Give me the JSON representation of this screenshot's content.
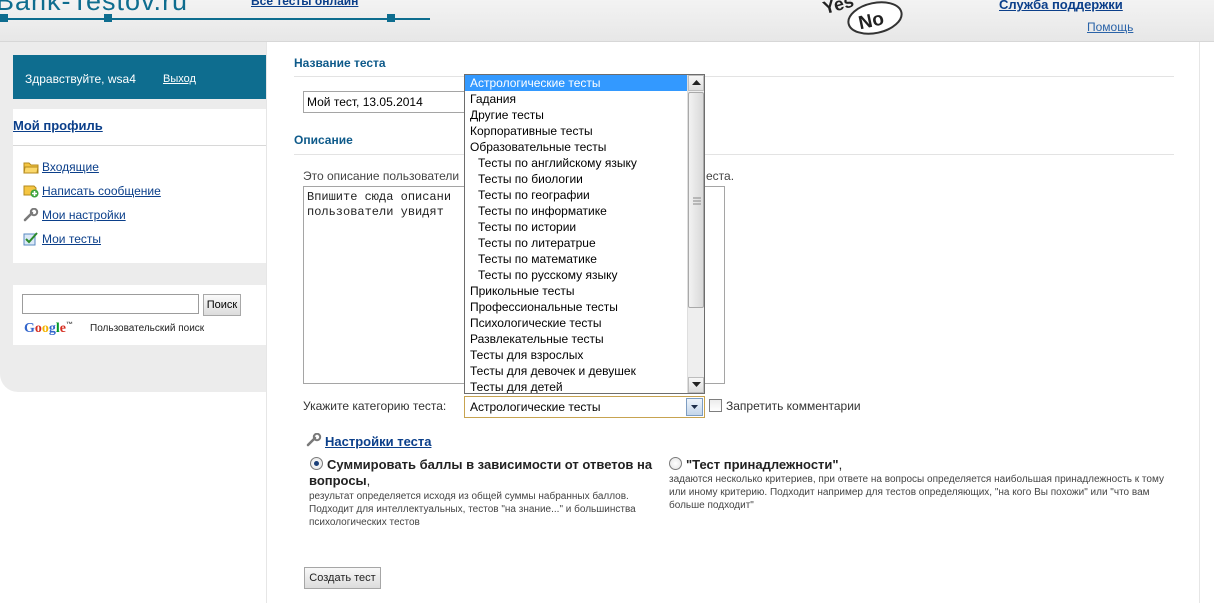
{
  "header": {
    "logo_text": "Bank-Testov.ru",
    "all_tests_link": "Все тесты онлайн",
    "badge_yes": "Yes",
    "badge_no": "No",
    "support_link": "Служба поддержки",
    "help_link": "Помощь"
  },
  "sidebar": {
    "greeting": "Здравствуйте, wsa4",
    "logout": "Выход",
    "profile_link": "Мой профиль",
    "items": [
      {
        "label": "Входящие",
        "icon": "folder-icon"
      },
      {
        "label": "Написать сообщение",
        "icon": "new-message-icon"
      },
      {
        "label": "Мои настройки",
        "icon": "wrench-icon"
      },
      {
        "label": "Мои тесты",
        "icon": "checkbox-icon"
      }
    ],
    "search": {
      "value": "",
      "button": "Поиск",
      "google_caption": "Пользовательский поиск"
    }
  },
  "form": {
    "name_section_title": "Название теста",
    "test_name_value": "Мой тест, 13.05.2014",
    "description_section_title": "Описание",
    "description_hint": "Это описание пользователи",
    "description_hint_tail": "еста.",
    "description_text": "Впишите сюда описани\nпользователи увидят",
    "category_label": "Укажите категорию теста:",
    "category_selected": "Астрологические тесты",
    "no_comments_label": "Запретить комментарии",
    "no_comments_checked": false,
    "category_options": [
      {
        "label": "Астрологические тесты",
        "level": 0,
        "selected": true
      },
      {
        "label": "Гадания",
        "level": 0
      },
      {
        "label": "Другие тесты",
        "level": 0
      },
      {
        "label": "Корпоративные тесты",
        "level": 0
      },
      {
        "label": "Образовательные тесты",
        "level": 0
      },
      {
        "label": "Тесты по английскому языку",
        "level": 1
      },
      {
        "label": "Тесты по биологии",
        "level": 1
      },
      {
        "label": "Тесты по географии",
        "level": 1
      },
      {
        "label": "Тесты по информатике",
        "level": 1
      },
      {
        "label": "Тесты по истории",
        "level": 1
      },
      {
        "label": "Тесты по литератрue",
        "level": 1
      },
      {
        "label": "Тесты по математике",
        "level": 1
      },
      {
        "label": "Тесты по русскому языку",
        "level": 1
      },
      {
        "label": "Прикольные тесты",
        "level": 0
      },
      {
        "label": "Профессиональные тесты",
        "level": 0
      },
      {
        "label": "Психологические тесты",
        "level": 0
      },
      {
        "label": "Развлекательные тесты",
        "level": 0
      },
      {
        "label": "Тесты для взрослых",
        "level": 0
      },
      {
        "label": "Тесты для девочек и девушек",
        "level": 0
      },
      {
        "label": "Тесты для детей",
        "level": 0
      }
    ]
  },
  "settings": {
    "title": "Настройки теста",
    "option_sum": {
      "title": "Суммировать баллы в зависимости от ответов на вопросы",
      "title_suffix": ",",
      "desc": "результат определяется исходя из общей суммы набранных баллов. Подходит для интеллектуальных, тестов \"на знание...\" и большинства психологических тестов",
      "checked": true
    },
    "option_belong": {
      "title": "\"Тест принадлежности\"",
      "title_suffix": ",",
      "desc": "задаются несколько критериев, при ответе на вопросы определяется наибольшая принадлежность к тому или иному критерию. Подходит например для тестов определяющих, \"на кого Вы похожи\" или \"что вам больше подходит\"",
      "checked": false
    },
    "create_button": "Создать тест"
  },
  "colors": {
    "brand": "#0e6d8f",
    "link": "#0b3f8a",
    "selection": "#3399ff"
  }
}
